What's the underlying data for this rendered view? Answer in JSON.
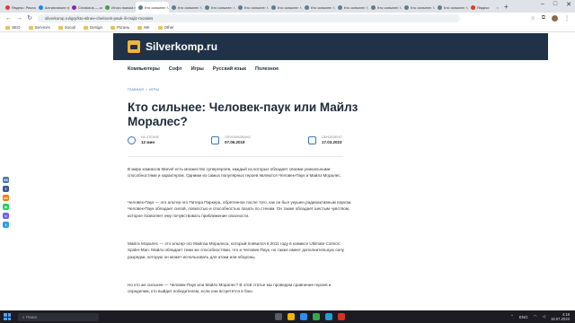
{
  "browser": {
    "tabs": [
      {
        "label": "Яндекс: Рекламная сеть",
        "color": "#e53935",
        "active": false
      },
      {
        "label": "Антиплагиат проверка",
        "color": "#1e88e5",
        "active": false
      },
      {
        "label": "Creatorus — конструктор",
        "color": "#8e24aa",
        "active": false
      },
      {
        "label": "Итоги поиска по разной",
        "color": "#43a047",
        "active": false
      },
      {
        "label": "Кто сильнее: Человек-п",
        "color": "#607d8b",
        "active": true
      },
      {
        "label": "Кто сильнее: Человек-п",
        "color": "#607d8b",
        "active": false
      },
      {
        "label": "Кто сильнее: Человек-п",
        "color": "#607d8b",
        "active": false
      },
      {
        "label": "Кто сильнее: Человек-п",
        "color": "#607d8b",
        "active": false
      },
      {
        "label": "Кто сильнее: Человек-п",
        "color": "#607d8b",
        "active": false
      },
      {
        "label": "Кто сильнее: Человек-п",
        "color": "#607d8b",
        "active": false
      },
      {
        "label": "Кто сильнее: Человек-п",
        "color": "#607d8b",
        "active": false
      },
      {
        "label": "Кто сильнее: Человек-п",
        "color": "#607d8b",
        "active": false
      },
      {
        "label": "Кто сильнее: Человек-п",
        "color": "#607d8b",
        "active": false
      },
      {
        "label": "Кто сильнее: Человек-п",
        "color": "#607d8b",
        "active": false
      },
      {
        "label": "Яндекс",
        "color": "#e53935",
        "active": false
      }
    ],
    "url": "silverkomp.ru/igry/kto-silnee-chelovek-pauk-ili-majlz-morales",
    "bookmarks": [
      "SEO",
      "Services",
      "Social",
      "Design",
      "Рогань",
      "Me",
      "Other"
    ]
  },
  "site": {
    "logo_text": "Silverkomp.ru",
    "nav": [
      "Компьютеры",
      "Софт",
      "Игры",
      "Русский язык",
      "Полезное"
    ]
  },
  "article": {
    "breadcrumb": [
      "ГЛАВНАЯ",
      "ИГРЫ"
    ],
    "title": "Кто сильнее: Человек-паук или Майлз Моралес?",
    "meta": [
      {
        "label": "НА ЧТЕНИЕ",
        "value": "12 мин",
        "icon": "clock-icon"
      },
      {
        "label": "ОПУБЛИКОВАНО",
        "value": "07.06.2019",
        "icon": "calendar-icon"
      },
      {
        "label": "ОБНОВЛЕНО",
        "value": "17.03.2023",
        "icon": "calendar-icon"
      }
    ],
    "paragraphs": [
      "В мире комиксов Marvel есть множество супергероев, каждый из которых обладает своими уникальными способностями и характером. Одними из самых популярных героев являются Человек-Паук и Майлз Моралес.",
      "Человек-Паук — это альтер-эго Питера Паркера, обретенное после того, как он был укушен радиоактивным пауком. Человек-Паук обладает силой, ловкостью и способностью лазать по стенам. Он также обладает шестым чувством, которое позволяет ему почувствовать приближение опасности.",
      "Майлз Моралес — это альтер-эго Майлза Моралеса, который появился в 2011 году в комиксе Ultimate Comics: Spider-Man. Майлз обладает теми же способностями, что и Человек-Паук, но также имеет дополнительную силу разрядки, которую он может использовать для атаки или обороны.",
      "Но кто же сильнее — Человек-Паук или Майлз Моралес? В этой статье мы проведем сравнение героев и определим, кто выйдет победителем, если они встретятся в бою."
    ]
  },
  "share": [
    {
      "label": "VK",
      "color": "#4a76a8"
    },
    {
      "label": "f",
      "color": "#3b5998"
    },
    {
      "label": "ok",
      "color": "#ee8208"
    },
    {
      "label": "w",
      "color": "#25d366"
    },
    {
      "label": "v",
      "color": "#7360f2"
    },
    {
      "label": "t",
      "color": "#2aa3df"
    }
  ],
  "taskbar": {
    "search_placeholder": "Поиск",
    "lang": "ENG",
    "time": "4:18",
    "date": "18.07.2023"
  }
}
